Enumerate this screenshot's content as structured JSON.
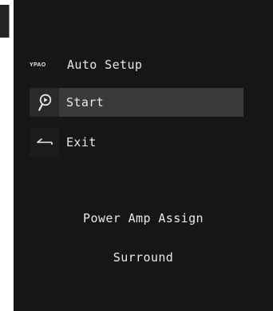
{
  "header": {
    "logo_text": "YPAO",
    "title": "Auto Setup"
  },
  "menu": {
    "items": [
      {
        "label": "Start",
        "icon": "microphone-icon",
        "selected": true
      },
      {
        "label": "Exit",
        "icon": "return-arrow-icon",
        "selected": false
      }
    ]
  },
  "info": {
    "line1": "Power Amp Assign",
    "line2": "Surround"
  },
  "colors": {
    "screen_background": "#161616",
    "selected_row": "#3a3a3a",
    "text": "#e8e8e8"
  }
}
